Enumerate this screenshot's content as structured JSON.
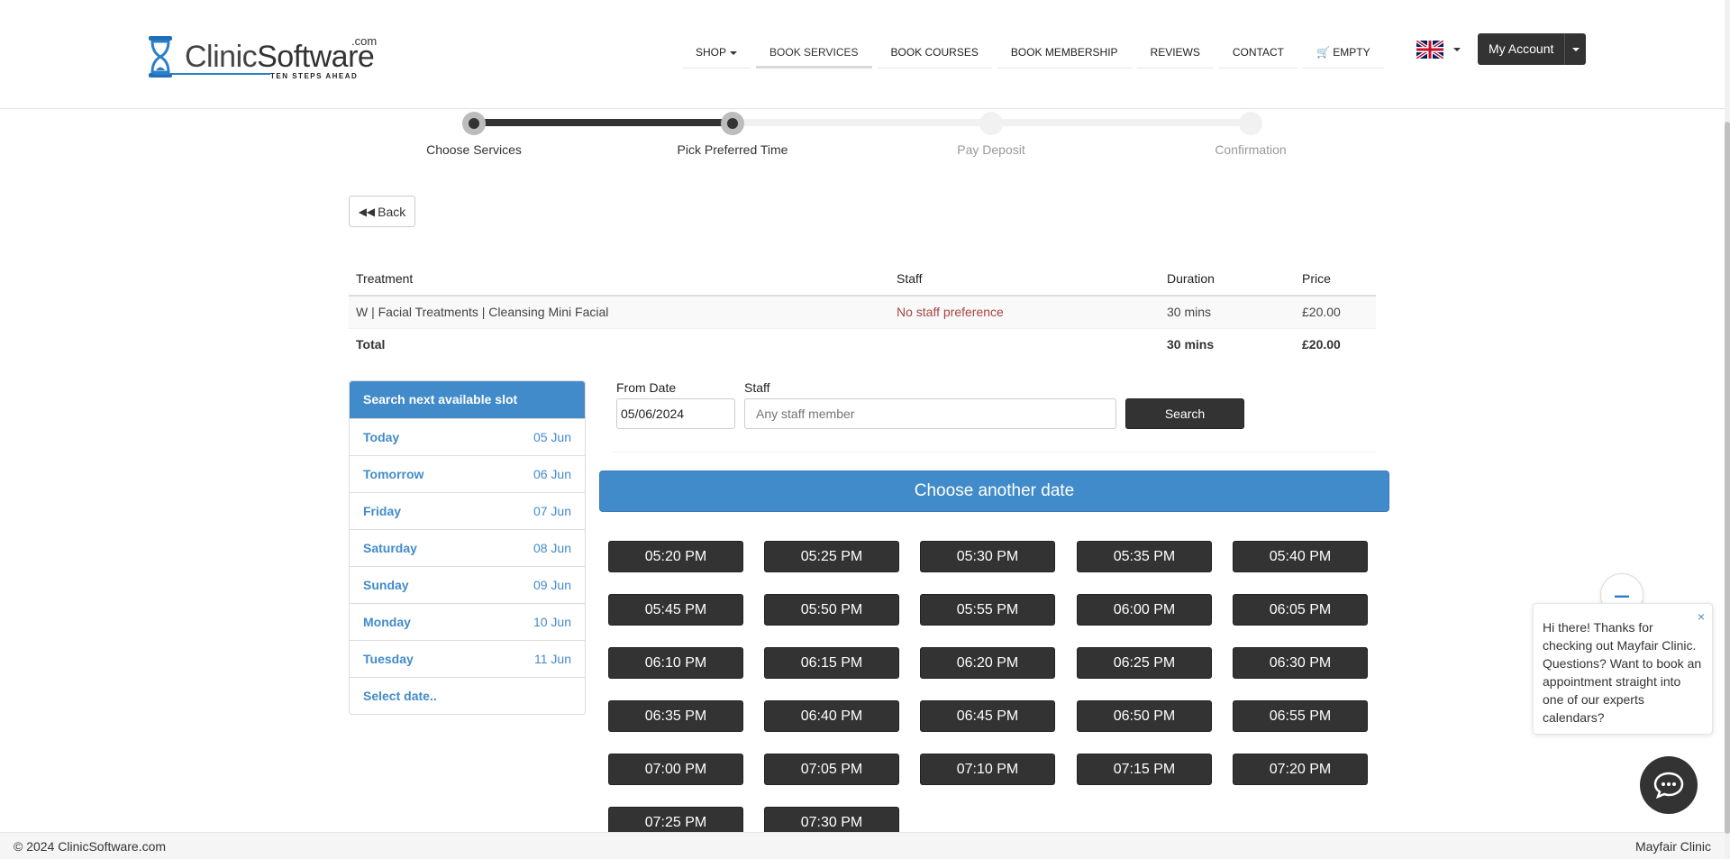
{
  "header": {
    "logo": {
      "word_a": "Clinic",
      "word_b": "Software",
      "com": ".com",
      "tagline": "TEN STEPS AHEAD"
    },
    "nav": [
      {
        "label": "SHOP",
        "has_caret": true
      },
      {
        "label": "BOOK SERVICES",
        "active": true
      },
      {
        "label": "BOOK COURSES"
      },
      {
        "label": "BOOK MEMBERSHIP"
      },
      {
        "label": "REVIEWS"
      },
      {
        "label": "CONTACT"
      },
      {
        "label": "EMPTY",
        "icon": "cart-icon"
      }
    ],
    "language_icon": "uk-flag-icon",
    "account_label": "My Account"
  },
  "stepper": {
    "steps": [
      {
        "label": "Choose Services",
        "done": true
      },
      {
        "label": "Pick Preferred Time",
        "done": true
      },
      {
        "label": "Pay Deposit",
        "done": false
      },
      {
        "label": "Confirmation",
        "done": false
      }
    ]
  },
  "back_label": "Back",
  "services_table": {
    "headers": [
      "Treatment",
      "Staff",
      "Duration",
      "Price"
    ],
    "rows": [
      {
        "treatment": "W | Facial Treatments | Cleansing Mini Facial",
        "staff": "No staff preference",
        "duration": "30 mins",
        "price": "£20.00"
      }
    ],
    "total": {
      "label": "Total",
      "duration": "30 mins",
      "price": "£20.00"
    }
  },
  "slot_panel": {
    "title": "Search next available slot",
    "items": [
      {
        "day": "Today",
        "date": "05 Jun"
      },
      {
        "day": "Tomorrow",
        "date": "06 Jun"
      },
      {
        "day": "Friday",
        "date": "07 Jun"
      },
      {
        "day": "Saturday",
        "date": "08 Jun"
      },
      {
        "day": "Sunday",
        "date": "09 Jun"
      },
      {
        "day": "Monday",
        "date": "10 Jun"
      },
      {
        "day": "Tuesday",
        "date": "11 Jun"
      }
    ],
    "select_date": "Select date.."
  },
  "search": {
    "from_label": "From Date",
    "from_value": "05/06/2024",
    "staff_label": "Staff",
    "staff_placeholder": "Any staff member",
    "button": "Search"
  },
  "choose_another_date": "Choose another date",
  "times": [
    "05:20 PM",
    "05:25 PM",
    "05:30 PM",
    "05:35 PM",
    "05:40 PM",
    "05:45 PM",
    "05:50 PM",
    "05:55 PM",
    "06:00 PM",
    "06:05 PM",
    "06:10 PM",
    "06:15 PM",
    "06:20 PM",
    "06:25 PM",
    "06:30 PM",
    "06:35 PM",
    "06:40 PM",
    "06:45 PM",
    "06:50 PM",
    "06:55 PM",
    "07:00 PM",
    "07:05 PM",
    "07:10 PM",
    "07:15 PM",
    "07:20 PM",
    "07:25 PM",
    "07:30 PM"
  ],
  "chat": {
    "message": "Hi there! Thanks for checking out Mayfair Clinic. Questions? Want to book an appointment straight into one of our experts calendars?",
    "close": "×"
  },
  "footer": {
    "left": "© 2024 ClinicSoftware.com",
    "right": "Mayfair Clinic"
  },
  "colors": {
    "primary_blue": "#428bca",
    "dark_button": "#333333",
    "staff_red": "#a94442"
  }
}
